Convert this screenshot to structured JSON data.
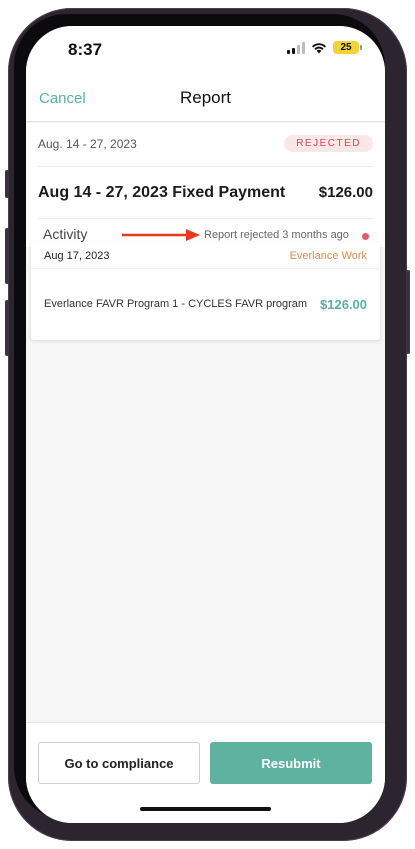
{
  "status_bar": {
    "time": "8:37",
    "battery": "25",
    "icons": [
      "signal-icon",
      "wifi-icon",
      "battery-icon"
    ]
  },
  "nav": {
    "cancel_label": "Cancel",
    "title": "Report"
  },
  "report": {
    "date_range": "Aug. 14 - 27, 2023",
    "status": "REJECTED",
    "payment_title": "Aug 14 - 27, 2023 Fixed Payment",
    "payment_amount": "$126.00",
    "activity_label": "Activity",
    "activity_status": "Report rejected 3 months ago"
  },
  "items": [
    {
      "date": "Aug 17, 2023",
      "category": "Everlance Work",
      "description": "Everlance FAVR Program 1 - CYCLES FAVR program",
      "amount": "$126.00"
    }
  ],
  "actions": {
    "compliance_label": "Go to compliance",
    "resubmit_label": "Resubmit"
  },
  "colors": {
    "accent": "#5fb2a0",
    "rejected": "#d2444e",
    "category": "#e08a4a",
    "annotation_arrow": "#e8391f"
  }
}
